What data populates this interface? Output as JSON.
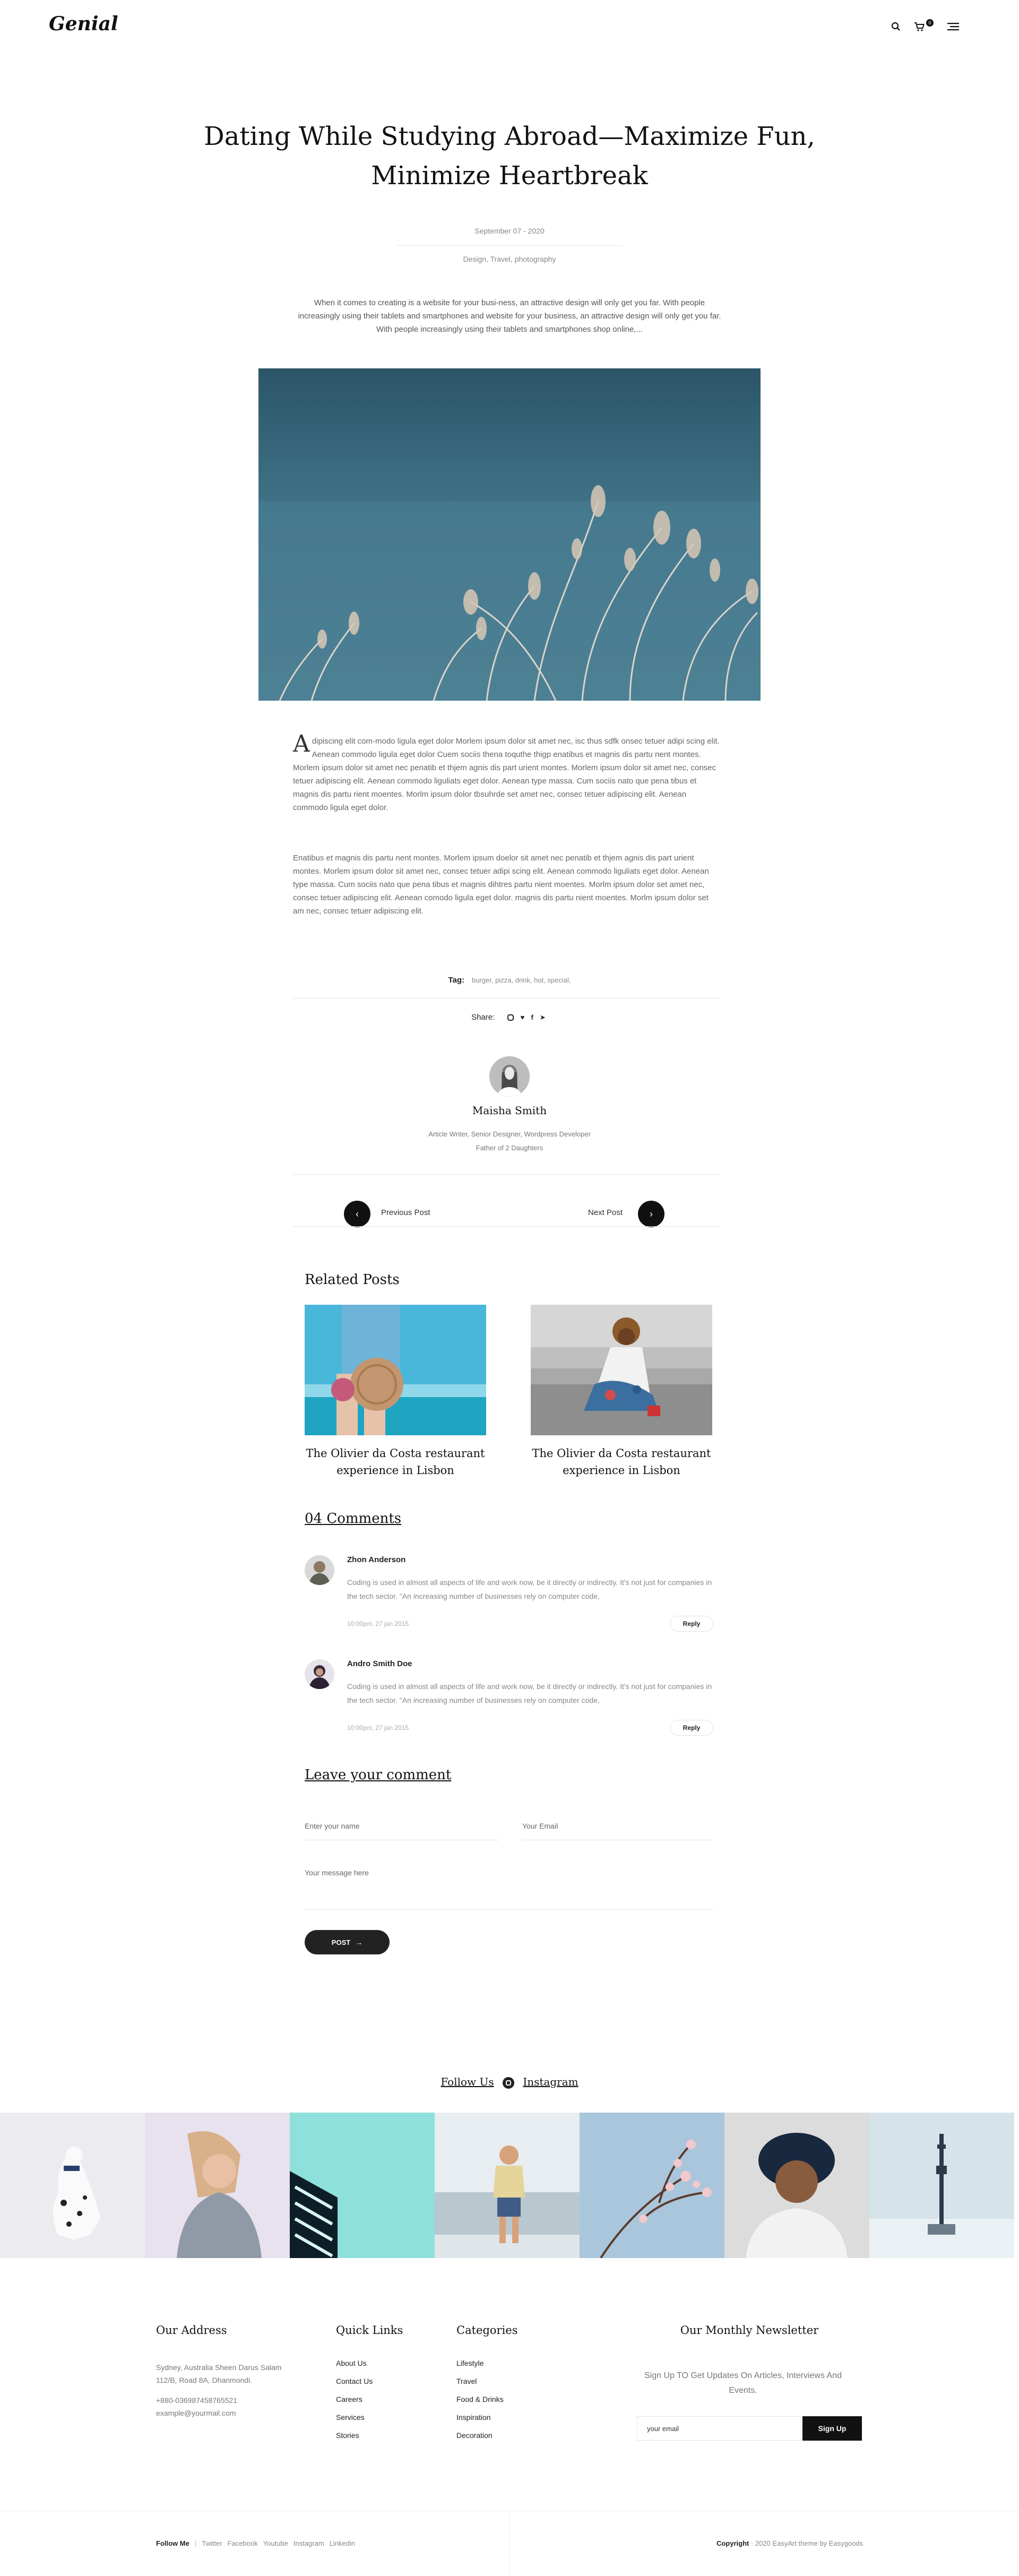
{
  "header": {
    "logo": "Genial",
    "cart_count": "0"
  },
  "article": {
    "title": "Dating While Studying Abroad—Maximize Fun, Minimize Heartbreak",
    "date": "September 07 - 2020",
    "categories": "Design,  Travel,  photography",
    "intro": "When it comes to creating is a website for your busi-ness, an attractive design will only get you far. With people increasingly using their tablets and smartphones and website for your business, an attractive design will only get you far. With people increasingly using their tablets and smartphones shop online,...",
    "dropcap": "A",
    "paragraph1": "dipiscing elit com-modo ligula eget dolor Morlem ipsum dolor sit amet nec, isc thus sdfk onsec tetuer adipi scing elit. Aenean commodo ligula eget dolor Cuem sociis thena toquthe thigp enatibus et magnis dis partu nent montes. Morlem ipsum dolor sit amet nec penatib et thjem agnis dis part urient montes. Morlem ipsum dolor sit amet nec, consec tetuer adipiscing elit. Aenean commodo liguliats eget dolor. Aenean type massa. Cum sociis nato que pena tibus et magnis dis partu rient moentes. Morlm ipsum dolor tbsuhrde set amet nec, consec tetuer adipiscing elit. Aenean commodo ligula eget dolor.",
    "paragraph2": "Enatibus et magnis dis partu nent montes. Morlem ipsum doelor sit amet nec penatib et thjem agnis dis part urient montes. Morlem ipsum dolor sit amet nec, consec tetuer adipi scing elit. Aenean commodo liguliats eget dolor. Aenean type massa. Cum sociis nato que pena tibus et magnis dihtres partu nient moentes. Morlm ipsum dolor set amet nec, consec tetuer adipiscing elit. Aenean comodo ligula eget dolor. magnis dis partu nient moentes. Morlm ipsum dolor set am nec, consec tetuer adipiscing elit."
  },
  "tags": {
    "label": "Tag:",
    "items": "burger,  pizza,  drink,  hot,  special,"
  },
  "share": {
    "label": "Share:"
  },
  "author": {
    "name": "Maisha Smith",
    "bio_line1": "Article Writer, Senior Designer, Wordpress Developer",
    "bio_line2": "Father of 2 Daughters"
  },
  "post_nav": {
    "previous": "Previous Post",
    "next": "Next Post"
  },
  "related": {
    "heading": "Related Posts",
    "posts": [
      {
        "title": "The Olivier da Costa restaurant experience in Lisbon"
      },
      {
        "title": "The Olivier da Costa restaurant experience in Lisbon"
      }
    ]
  },
  "comments": {
    "heading": "04 Comments",
    "items": [
      {
        "name": "Zhon Anderson",
        "text": "Coding is used in almost all aspects of life and work now, be it directly or indirectly. It's not just for companies in the tech sector. \"An increasing number of businesses rely on computer code,",
        "date": "10:00pm, 27 jan 2015",
        "reply": "Reply"
      },
      {
        "name": "Andro Smith Doe",
        "text": "Coding is used in almost all aspects of life and work now, be it directly or indirectly. It's not just for companies in the tech sector. \"An increasing number of businesses rely on computer code,",
        "date": "10:00pm, 27 jan 2015",
        "reply": "Reply"
      }
    ]
  },
  "comment_form": {
    "heading": "Leave your comment",
    "name_placeholder": "Enter your name",
    "email_placeholder": "Your Email",
    "message_placeholder": "Your message here",
    "submit": "POST"
  },
  "instagram": {
    "follow": "Follow Us",
    "network": "Instagram"
  },
  "footer": {
    "address_heading": "Our Address",
    "address": "Sydney, Australia Sheen Darus Salam 112/B, Road 8A, Dhanmondi.",
    "phone": "+880-036987458765521",
    "email": "example@yourmail.com",
    "quick_links_heading": "Quick Links",
    "quick_links": [
      "About Us",
      "Contact Us",
      "Careers",
      "Services",
      "Stories"
    ],
    "categories_heading": "Categories",
    "categories": [
      "Lifestyle",
      "Travel",
      "Food & Drinks",
      "Inspiration",
      "Decoration"
    ],
    "newsletter_heading": "Our Monthly Newsletter",
    "newsletter_text": "Sign Up TO Get Updates On Articles, Interviews And Events.",
    "newsletter_placeholder": "your email",
    "newsletter_button": "Sign Up",
    "follow_me": "Follow Me",
    "socials": [
      "Twitter",
      "Facebook",
      "Youtube",
      "Instagram",
      "Linkedin"
    ],
    "copyright_label": "Copyright",
    "copyright_text": "· 2020 EasyArt theme by Easygoods"
  },
  "colors": {
    "text": "#222222",
    "muted": "#888888",
    "button": "#111111"
  }
}
